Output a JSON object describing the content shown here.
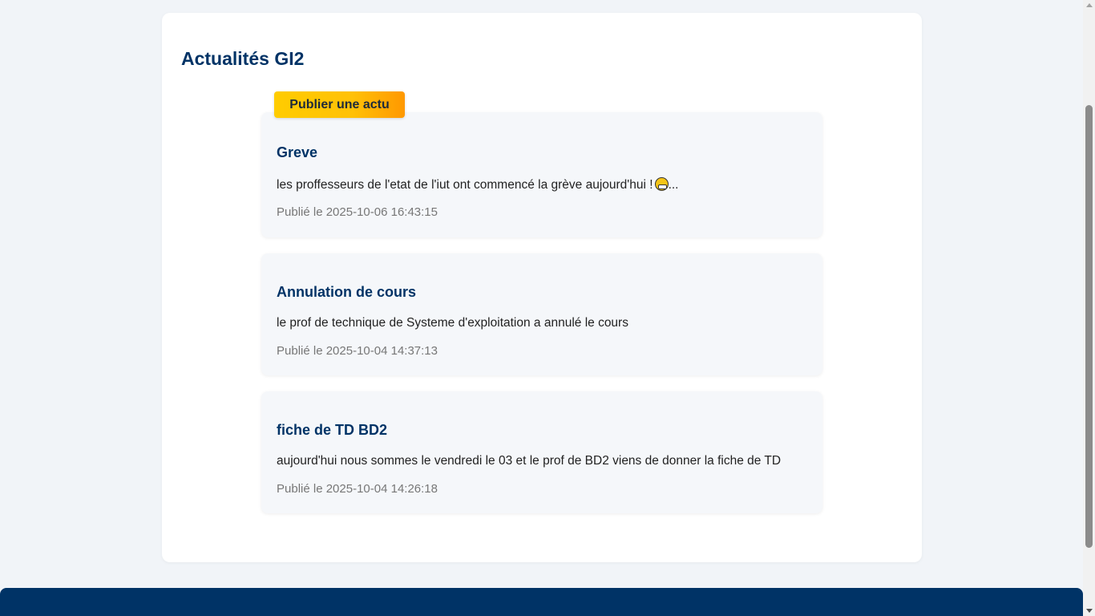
{
  "page": {
    "section_title": "Actualités GI2",
    "publish_button_label": "Publier une actu"
  },
  "news": [
    {
      "title": "Greve",
      "text_before_emoji": "les proffesseurs de l'etat de l'iut ont commencé la grève aujourd'hui !",
      "emoji": "grimacing-face-icon",
      "text_after_emoji": "...",
      "date": "Publié le 2025-10-06 16:43:15"
    },
    {
      "title": "Annulation de cours",
      "text": "le prof de technique de Systeme d'exploitation a annulé le cours",
      "date": "Publié le 2025-10-04 14:37:13"
    },
    {
      "title": "fiche de TD BD2",
      "text": "aujourd'hui nous sommes le vendredi le 03 et le prof de BD2 viens de donner la fiche de TD",
      "date": "Publié le 2025-10-04 14:26:18"
    }
  ],
  "colors": {
    "page_background": "#f1f4f8",
    "primary_navy": "#003366",
    "accent_yellow": "#ffc107",
    "accent_orange": "#ff9800",
    "card_background": "#f5f7fa",
    "date_gray": "#777777"
  }
}
